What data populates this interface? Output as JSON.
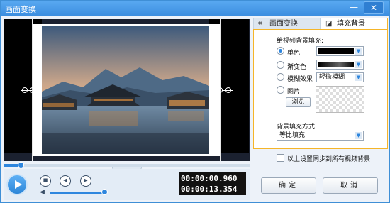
{
  "window": {
    "title": "画面变换",
    "minimize_glyph": "—",
    "close_glyph": "✕"
  },
  "player": {
    "current_time": "00:00:00.960",
    "total_time": "00:00:13.354",
    "progress_fraction": 0.07,
    "volume_fraction": 0.95,
    "stop_glyph": "■",
    "prev_glyph": "◀",
    "next_glyph": "▶",
    "volume_glyph": "◀",
    "collapse_glyph": "⌄"
  },
  "tabs": [
    {
      "label": "画面变换",
      "icon": "crop-icon",
      "active": false
    },
    {
      "label": "填充背景",
      "icon": "fill-icon",
      "active": true
    }
  ],
  "fill": {
    "heading": "给视频背景填充:",
    "options": [
      {
        "label": "单色",
        "selected": true
      },
      {
        "label": "渐变色",
        "selected": false
      },
      {
        "label": "模糊效果",
        "selected": false
      },
      {
        "label": "图片",
        "selected": false
      }
    ],
    "blur_value": "轻微模糊",
    "browse_label": "浏览",
    "method_heading": "背景填充方式:",
    "method_value": "等比填充",
    "solid_color": "#000000"
  },
  "sync_label": "以上设置同步到所有视频背景",
  "buttons": {
    "confirm": "确定",
    "cancel": "取消"
  },
  "colors": {
    "accent": "#2e86de",
    "title_bar": "#3c8ee0",
    "panel_border": "#f5b529"
  }
}
